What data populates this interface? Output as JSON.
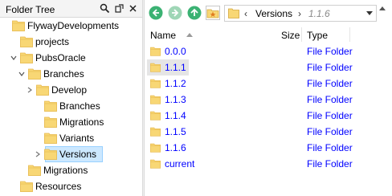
{
  "left_pane": {
    "title": "Folder Tree",
    "icons": [
      "search-icon",
      "unpin-icon",
      "close-icon"
    ],
    "tree": [
      {
        "label": "FlywayDevelopments",
        "depth": 0,
        "chevron": "none",
        "selected": false
      },
      {
        "label": "projects",
        "depth": 1,
        "chevron": "none",
        "selected": false
      },
      {
        "label": "PubsOracle",
        "depth": 1,
        "chevron": "expanded",
        "selected": false
      },
      {
        "label": "Branches",
        "depth": 2,
        "chevron": "expanded",
        "selected": false
      },
      {
        "label": "Develop",
        "depth": 3,
        "chevron": "collapsed",
        "selected": false
      },
      {
        "label": "Branches",
        "depth": 4,
        "chevron": "none",
        "selected": false
      },
      {
        "label": "Migrations",
        "depth": 4,
        "chevron": "none",
        "selected": false
      },
      {
        "label": "Variants",
        "depth": 4,
        "chevron": "none",
        "selected": false
      },
      {
        "label": "Versions",
        "depth": 4,
        "chevron": "collapsed",
        "selected": true
      },
      {
        "label": "Migrations",
        "depth": 2,
        "chevron": "none",
        "selected": false
      },
      {
        "label": "Resources",
        "depth": 1,
        "chevron": "none",
        "selected": false
      }
    ]
  },
  "toolbar": {
    "back": "back-icon",
    "forward": "forward-icon",
    "up": "up-icon",
    "favorites": "favorites-folder-icon"
  },
  "address_bar": {
    "crumbs": [
      "Versions",
      "1.1.6"
    ],
    "separator": "›",
    "back_arrow": "‹"
  },
  "columns": {
    "name": "Name",
    "size": "Size",
    "type": "Type"
  },
  "files": [
    {
      "name": "0.0.0",
      "type": "File Folder",
      "highlighted": false
    },
    {
      "name": "1.1.1",
      "type": "File Folder",
      "highlighted": true
    },
    {
      "name": "1.1.2",
      "type": "File Folder",
      "highlighted": false
    },
    {
      "name": "1.1.3",
      "type": "File Folder",
      "highlighted": false
    },
    {
      "name": "1.1.4",
      "type": "File Folder",
      "highlighted": false
    },
    {
      "name": "1.1.5",
      "type": "File Folder",
      "highlighted": false
    },
    {
      "name": "1.1.6",
      "type": "File Folder",
      "highlighted": false
    },
    {
      "name": "current",
      "type": "File Folder",
      "highlighted": false
    }
  ],
  "colors": {
    "folder": "#f8d775",
    "folder_dark": "#e6b84b",
    "link": "#0000ff",
    "nav_green": "#3bb273",
    "selection": "#cce8ff"
  }
}
